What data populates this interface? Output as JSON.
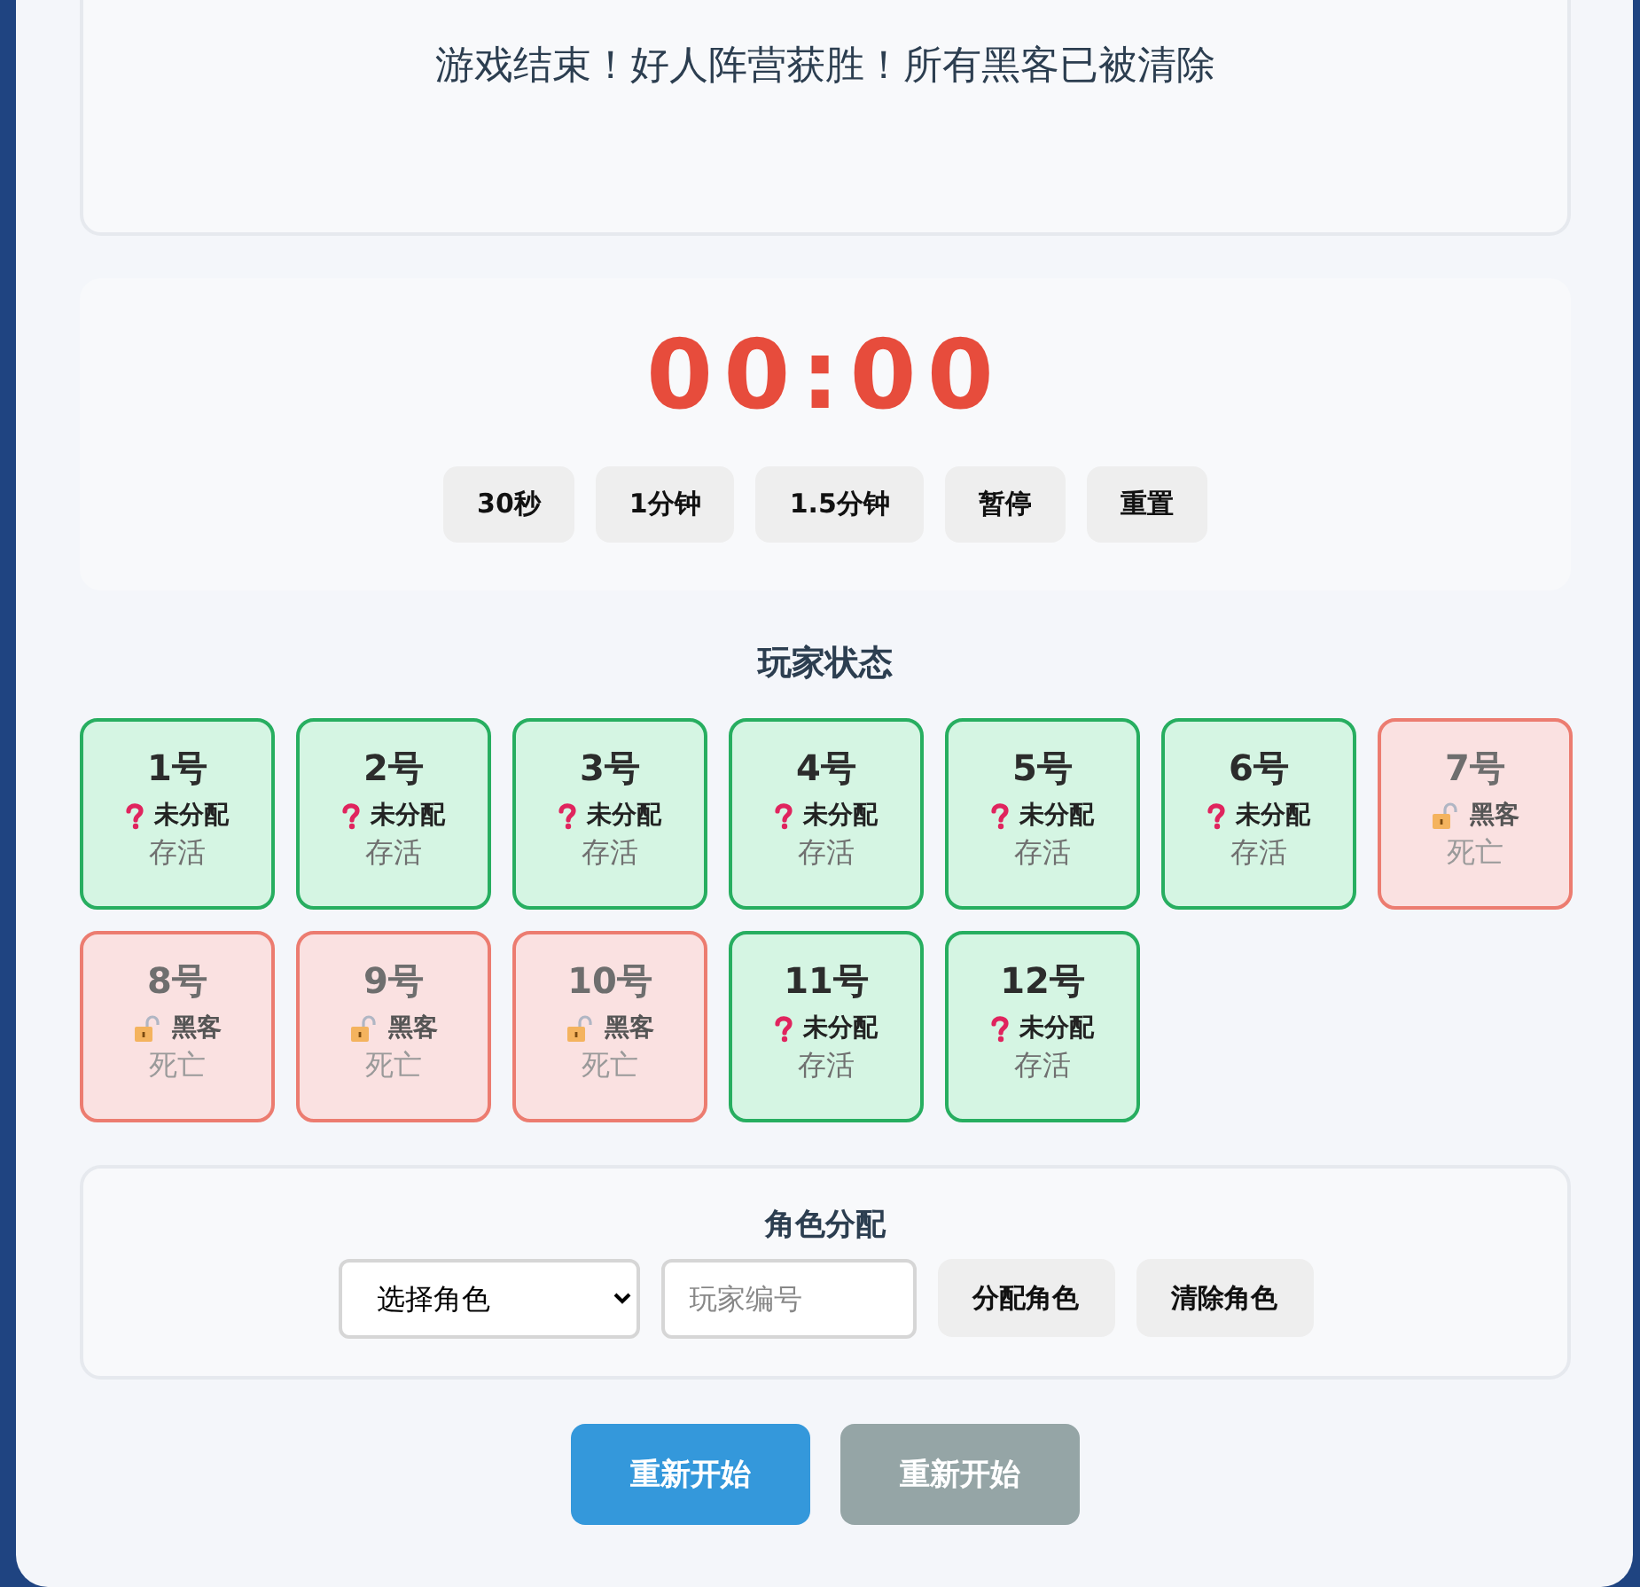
{
  "message": "游戏结束！好人阵营获胜！所有黑客已被清除",
  "timer": {
    "display": "00:00",
    "buttons": [
      "30秒",
      "1分钟",
      "1.5分钟",
      "暂停",
      "重置"
    ]
  },
  "players_title": "玩家状态",
  "players": [
    {
      "number": "1号",
      "role": "未分配",
      "kind": "question",
      "status": "存活",
      "alive": true
    },
    {
      "number": "2号",
      "role": "未分配",
      "kind": "question",
      "status": "存活",
      "alive": true
    },
    {
      "number": "3号",
      "role": "未分配",
      "kind": "question",
      "status": "存活",
      "alive": true
    },
    {
      "number": "4号",
      "role": "未分配",
      "kind": "question",
      "status": "存活",
      "alive": true
    },
    {
      "number": "5号",
      "role": "未分配",
      "kind": "question",
      "status": "存活",
      "alive": true
    },
    {
      "number": "6号",
      "role": "未分配",
      "kind": "question",
      "status": "存活",
      "alive": true
    },
    {
      "number": "7号",
      "role": "黑客",
      "kind": "lock",
      "status": "死亡",
      "alive": false
    },
    {
      "number": "8号",
      "role": "黑客",
      "kind": "lock",
      "status": "死亡",
      "alive": false
    },
    {
      "number": "9号",
      "role": "黑客",
      "kind": "lock",
      "status": "死亡",
      "alive": false
    },
    {
      "number": "10号",
      "role": "黑客",
      "kind": "lock",
      "status": "死亡",
      "alive": false
    },
    {
      "number": "11号",
      "role": "未分配",
      "kind": "question",
      "status": "存活",
      "alive": true
    },
    {
      "number": "12号",
      "role": "未分配",
      "kind": "question",
      "status": "存活",
      "alive": true
    }
  ],
  "role_assign": {
    "title": "角色分配",
    "select": "选择角色",
    "player_placeholder": "玩家编号",
    "buttons": [
      "分配角色",
      "清除角色"
    ]
  },
  "restart_buttons": [
    {
      "label": "重新开始",
      "disabled": false
    },
    {
      "label": "重新开始",
      "disabled": true
    }
  ]
}
